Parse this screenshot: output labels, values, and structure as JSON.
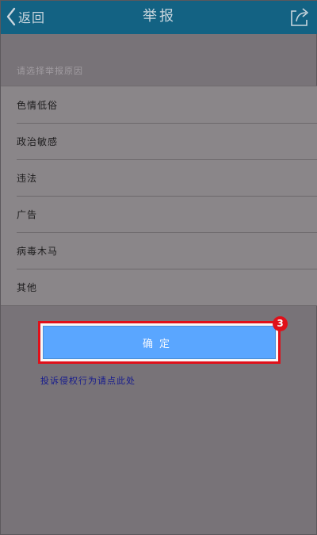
{
  "header": {
    "back_label": "返回",
    "title": "举报",
    "back_icon": "chevron-left-icon",
    "share_icon": "share-icon"
  },
  "reasons": {
    "hint": "请选择举报原因",
    "items": [
      "色情低俗",
      "政治敏感",
      "违法",
      "广告",
      "病毒木马",
      "其他"
    ]
  },
  "confirm": {
    "label": "确定"
  },
  "step_badge": "3",
  "complaint_link": "投诉侵权行为请点此处",
  "colors": {
    "navbar": "#136283",
    "button": "#5aa6ff",
    "highlight": "#e0101a",
    "link": "#151a8e"
  }
}
